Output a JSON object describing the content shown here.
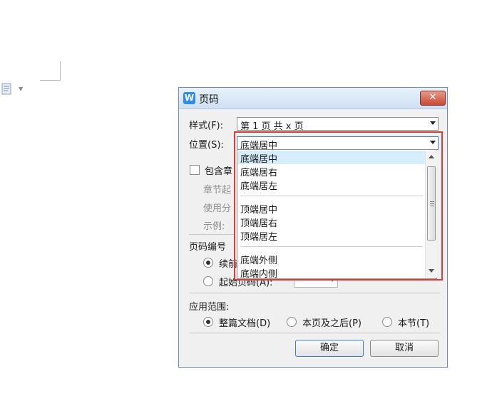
{
  "dialog": {
    "title": "页码",
    "logo": "W",
    "close_glyph": "✕"
  },
  "style_row": {
    "label": "样式(F):",
    "value": "第 1 页 共 x 页"
  },
  "position_row": {
    "label": "位置(S):",
    "value": "底端居中"
  },
  "include_chapter": {
    "label": "包含章"
  },
  "chapter_start": {
    "label": "章节起"
  },
  "use_separator": {
    "label": "使用分"
  },
  "example": {
    "label": "示例:"
  },
  "numbering": {
    "header": "页码编号",
    "continue_label": "续前",
    "start_label": "起始页码(A):"
  },
  "apply_scope": {
    "header": "应用范围:",
    "options": [
      "整篇文档(D)",
      "本页及之后(P)",
      "本节(T)"
    ]
  },
  "buttons": {
    "ok": "确定",
    "cancel": "取消"
  },
  "dropdown": {
    "items": [
      "底端居中",
      "底端居右",
      "底端居左",
      "顶端居中",
      "顶端居右",
      "顶端居左",
      "底端外侧",
      "底端内侧"
    ],
    "selected_index": 0
  },
  "colors": {
    "highlight": "#d0413a",
    "accent": "#2f8be6",
    "selection": "#d6eefb"
  },
  "icons": {
    "doc": "document-icon",
    "close": "close-icon"
  }
}
